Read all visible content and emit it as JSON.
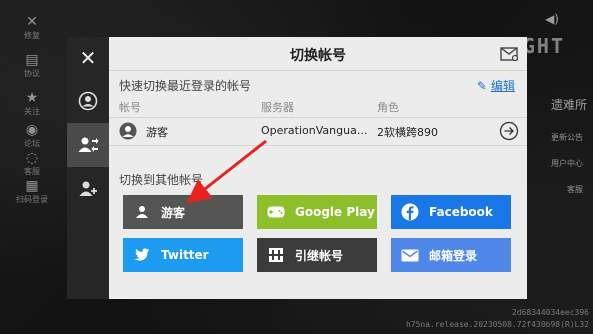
{
  "game": {
    "left_menu": [
      "修复",
      "协议",
      "关注",
      "论坛",
      "客服",
      "扫码登录"
    ],
    "logo": "LEFT  LIGHT",
    "right_title": "遗难所",
    "right_menu": [
      "更新公告",
      "用户中心",
      "客服"
    ],
    "version_line1": "2d68344034eec396",
    "version_line2": "h75na.release.20230508.72f430b98(R)L32"
  },
  "dialog": {
    "title": "切换帐号",
    "close_icon": "close-icon",
    "sidebar_tabs": [
      "account-icon",
      "switch-account-icon",
      "add-account-icon"
    ],
    "recent": {
      "label": "快速切换最近登录的帐号",
      "edit": "编辑",
      "headers": {
        "account": "帐号",
        "server": "服务器",
        "role": "角色"
      },
      "rows": [
        {
          "account": "游客",
          "server": "OperationVangua...",
          "role": "2软横跨890"
        }
      ]
    },
    "other": {
      "label": "切换到其他帐号",
      "buttons": [
        {
          "label": "游客",
          "color": "#555555",
          "icon": "guest-icon"
        },
        {
          "label": "Google Play",
          "color": "#8cbf2a",
          "icon": "gamepad-icon"
        },
        {
          "label": "Facebook",
          "color": "#1a77e8",
          "icon": "facebook-icon"
        },
        {
          "label": "Twitter",
          "color": "#1d9bf0",
          "icon": "twitter-icon"
        },
        {
          "label": "引继帐号",
          "color": "#3c3c3c",
          "icon": "transfer-icon"
        },
        {
          "label": "邮箱登录",
          "color": "#4f87e8",
          "icon": "mail-icon"
        }
      ]
    }
  },
  "colors": {
    "panel_bg": "#ececec",
    "sidebar_bg": "#262626",
    "link": "#1b6fd6",
    "annotation_arrow": "#e8231f"
  }
}
